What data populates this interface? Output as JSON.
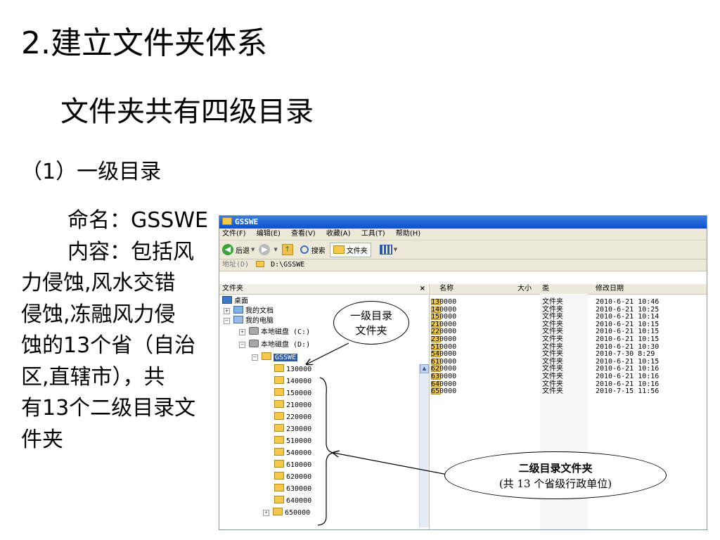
{
  "slide": {
    "title": "2.建立文件夹体系",
    "subtitle": "文件夹共有四级目录",
    "section": "（1）一级目录",
    "desc_lines": [
      "命名：GSSWE",
      "内容：包括风",
      "力侵蚀,风水交错",
      "侵蚀,冻融风力侵",
      "蚀的13个省（自治",
      "区,直辖市），共",
      "有13个二级目录文",
      "件夹"
    ]
  },
  "window": {
    "title": "GSSWE",
    "menu": [
      "文件(F)",
      "编辑(E)",
      "查看(V)",
      "收藏(A)",
      "工具(T)",
      "帮助(H)"
    ],
    "toolbar": {
      "back": "后退",
      "search": "搜索",
      "folders": "文件夹"
    },
    "address_label": "地址(D)",
    "address_value": "D:\\GSSWE",
    "tree_header": "文件夹",
    "tree": {
      "desktop": "桌面",
      "my_docs": "我的文档",
      "my_computer": "我的电脑",
      "disk_c": "本地磁盘 (C:)",
      "disk_d": "本地磁盘 (D:)",
      "selected": "GSSWE",
      "children": [
        "130000",
        "140000",
        "150000",
        "210000",
        "220000",
        "230000",
        "510000",
        "540000",
        "610000",
        "620000",
        "630000",
        "640000",
        "650000"
      ]
    },
    "columns": {
      "name": "名称",
      "size": "大小",
      "type": "类型",
      "modified": "修改日期"
    },
    "rows": [
      {
        "name": "130000",
        "type": "文件夹",
        "date": "2010-6-21 10:46"
      },
      {
        "name": "140000",
        "type": "文件夹",
        "date": "2010-6-21 10:25"
      },
      {
        "name": "150000",
        "type": "文件夹",
        "date": "2010-6-21 10:14"
      },
      {
        "name": "210000",
        "type": "文件夹",
        "date": "2010-6-21 10:15"
      },
      {
        "name": "220000",
        "type": "文件夹",
        "date": "2010-6-21 10:15"
      },
      {
        "name": "230000",
        "type": "文件夹",
        "date": "2010-6-21 10:15"
      },
      {
        "name": "510000",
        "type": "文件夹",
        "date": "2010-6-21 10:30"
      },
      {
        "name": "540000",
        "type": "文件夹",
        "date": "2010-7-30 8:29"
      },
      {
        "name": "610000",
        "type": "文件夹",
        "date": "2010-6-21 10:15"
      },
      {
        "name": "620000",
        "type": "文件夹",
        "date": "2010-6-21 10:16"
      },
      {
        "name": "630000",
        "type": "文件夹",
        "date": "2010-6-21 10:16"
      },
      {
        "name": "640000",
        "type": "文件夹",
        "date": "2010-6-21 10:16"
      },
      {
        "name": "650000",
        "type": "文件夹",
        "date": "2010-7-15 11:56"
      }
    ]
  },
  "callouts": {
    "level1": [
      "一级目录",
      "文件夹"
    ],
    "level2_title": "二级目录文件夹",
    "level2_note": "(共 13 个省级行政单位)"
  }
}
